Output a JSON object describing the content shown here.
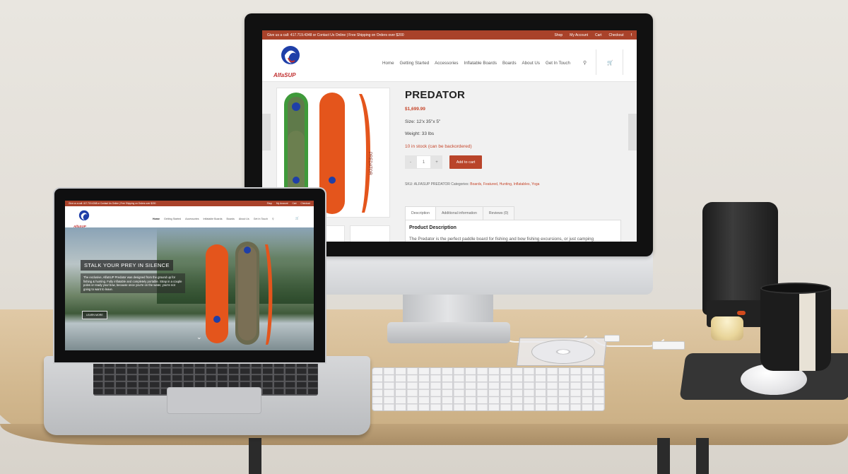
{
  "colors": {
    "brand_topbar": "#a9422a",
    "accent_price": "#c6472c",
    "add_to_cart_bg": "#b9442a"
  },
  "monitor_site": {
    "topbar": {
      "contact": "Give us a call: 417.719.4348 or Contact Us Online | Free Shipping on Orders over $200",
      "links": [
        "Shop",
        "My Account",
        "Cart",
        "Checkout"
      ],
      "social_icon": "facebook-icon"
    },
    "logo_text": "AlfaSUP",
    "nav": [
      "Home",
      "Getting Started",
      "Accessories",
      "Inflatable Boards",
      "Boards",
      "About Us",
      "Get In Touch"
    ],
    "search_icon": "search-icon",
    "cart_icon": "cart-icon",
    "product": {
      "title": "PREDATOR",
      "price": "$1,699.99",
      "size": "Size: 12'x 35\"x 5\"",
      "weight": "Weight: 33 lbs",
      "stock": "10 in stock (can be backordered)",
      "qty_minus": "-",
      "qty_value": "1",
      "qty_plus": "+",
      "add_to_cart": "Add to cart",
      "meta_prefix": "SKU: ALFASUP PREDATOR Categories: ",
      "meta_categories": "Boards, Featured, Hunting, Inflatables, Yoga",
      "board_side_text": "PREDATOR"
    },
    "tabs": [
      "Description",
      "Additional information",
      "Reviews (0)"
    ],
    "description_title": "Product Description",
    "description_text": "The Predator is the perfect paddle board for fishing and bow fishing excursions, or just camping"
  },
  "laptop_site": {
    "topbar": {
      "contact": "Give us a call: 417.719.4348 or Contact Us Online | Free Shipping on Orders over $200",
      "links": [
        "Shop",
        "My Account",
        "Cart",
        "Checkout"
      ]
    },
    "logo_text": "AlfaSUP",
    "nav": [
      "Home",
      "Getting Started",
      "Accessories",
      "Inflatable Boards",
      "Boards",
      "About Us",
      "Get In Touch"
    ],
    "hero": {
      "title": "STALK YOUR PREY IN SILENCE",
      "text": "The exclusive, AlfaSUP Predator was designed from the ground up for fishing & hunting. Fully inflatable and completely portable. Strap in a couple poles or ready your bow, because once you're on the water, you're not going to want to leave.",
      "button": "LEARN MORE",
      "scroll_icon": "chevron-down-icon"
    }
  }
}
